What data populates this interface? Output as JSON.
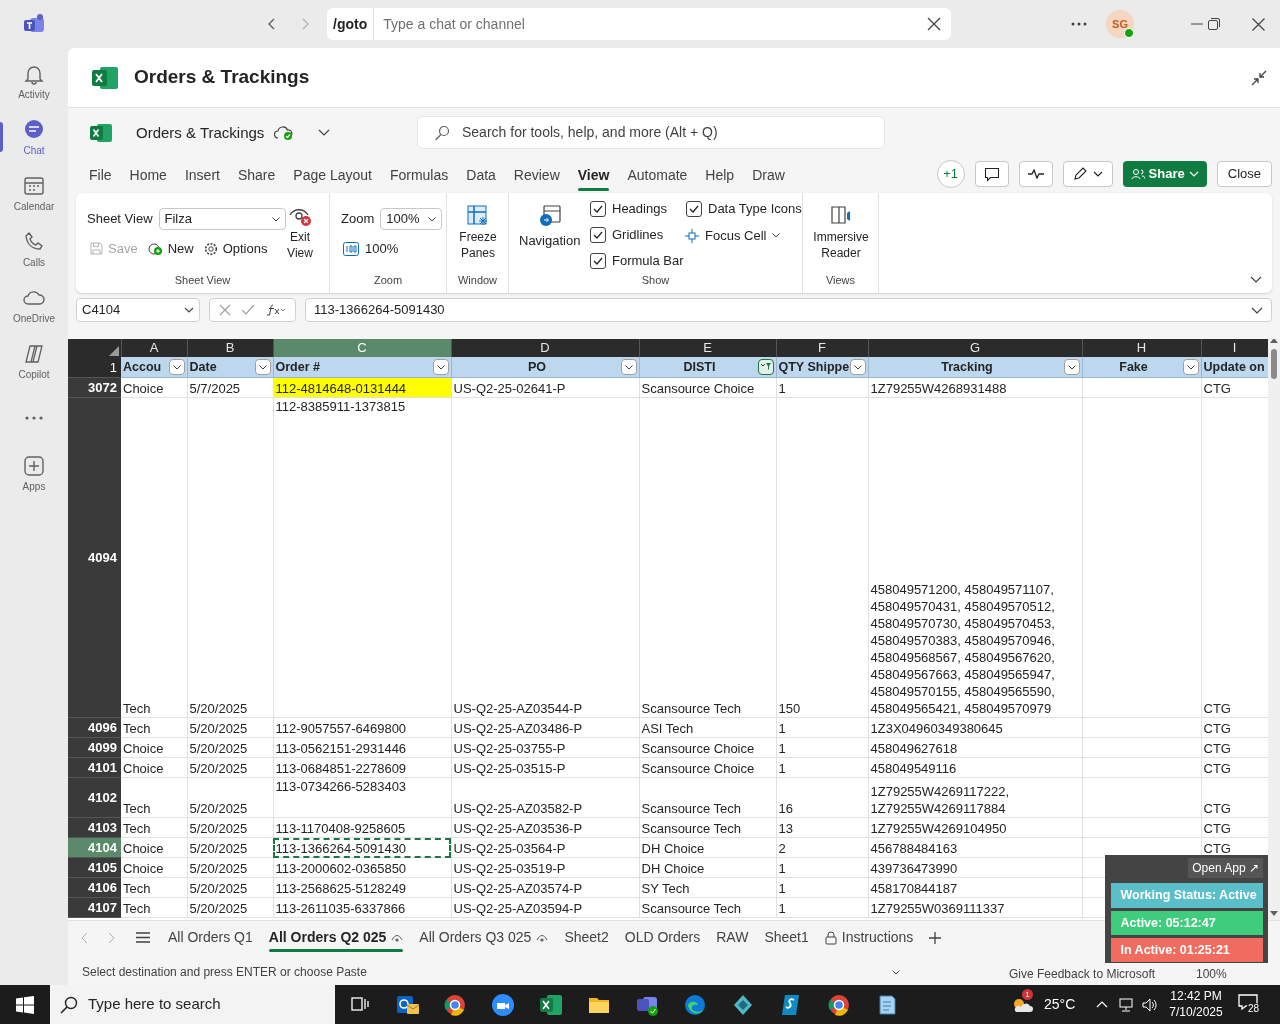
{
  "teams": {
    "search_prefix": "/goto",
    "search_placeholder": "Type a chat or channel",
    "avatar": "SG",
    "rail": [
      {
        "kind": "bell",
        "label": "Activity",
        "selected": false
      },
      {
        "kind": "chat",
        "label": "Chat",
        "selected": true
      },
      {
        "kind": "calendar",
        "label": "Calendar",
        "selected": false
      },
      {
        "kind": "phone",
        "label": "Calls",
        "selected": false
      },
      {
        "kind": "cloud",
        "label": "OneDrive",
        "selected": false
      },
      {
        "kind": "copilot",
        "label": "Copilot",
        "selected": false
      },
      {
        "kind": "more",
        "selected": false
      },
      {
        "kind": "apps",
        "label": "Apps",
        "selected": false
      }
    ]
  },
  "app_title": "Orders & Trackings",
  "workbook": {
    "name": "Orders & Trackings",
    "search_placeholder": "Search for tools, help, and more (Alt + Q)"
  },
  "ribbon_tabs": [
    {
      "label": "File",
      "selected": false
    },
    {
      "label": "Home",
      "selected": false
    },
    {
      "label": "Insert",
      "selected": false
    },
    {
      "label": "Share",
      "selected": false
    },
    {
      "label": "Page Layout",
      "selected": false
    },
    {
      "label": "Formulas",
      "selected": false
    },
    {
      "label": "Data",
      "selected": false
    },
    {
      "label": "Review",
      "selected": false
    },
    {
      "label": "View",
      "selected": true
    },
    {
      "label": "Automate",
      "selected": false
    },
    {
      "label": "Help",
      "selected": false
    },
    {
      "label": "Draw",
      "selected": false
    }
  ],
  "ribbon_actions": {
    "presence": "+1",
    "share": "Share",
    "close": "Close"
  },
  "sheet_view_group": {
    "title": "Sheet View",
    "label": "Sheet View",
    "view": "Filza",
    "exit": "Exit View",
    "save": {
      "label": "Save",
      "disabled": true
    },
    "new": "New",
    "options": "Options"
  },
  "zoom_group": {
    "title": "Zoom",
    "label": "Zoom",
    "value": "100%",
    "reset": "100%"
  },
  "window_group": {
    "title": "Window",
    "freeze": "Freeze Panes"
  },
  "show_group": {
    "title": "Show",
    "navigation": "Navigation",
    "options": [
      {
        "label": "Headings",
        "checked": true
      },
      {
        "label": "Gridlines",
        "checked": true
      },
      {
        "label": "Formula Bar",
        "checked": true
      },
      {
        "label": "Data Type Icons",
        "checked": true
      }
    ],
    "focus_cell": "Focus Cell"
  },
  "views_group": {
    "title": "Views",
    "immersive": "Immersive Reader"
  },
  "formula_bar": {
    "name_box": "C4104",
    "formula": "113-1366264-5091430"
  },
  "sheet": {
    "header_row": "1",
    "columns": [
      {
        "letter": "A",
        "label": "Accou",
        "filtered": false
      },
      {
        "letter": "B",
        "label": "Date",
        "filtered": false
      },
      {
        "letter": "C",
        "label": "Order #",
        "filtered": false
      },
      {
        "letter": "D",
        "label": "PO",
        "filtered": false
      },
      {
        "letter": "E",
        "label": "DISTI",
        "filtered": true
      },
      {
        "letter": "F",
        "label": "QTY Shippe",
        "filtered": false
      },
      {
        "letter": "G",
        "label": "Tracking",
        "filtered": false
      },
      {
        "letter": "H",
        "label": "Fake",
        "filtered": false
      },
      {
        "letter": "I",
        "label": "Update on"
      }
    ],
    "rows": [
      {
        "number": "3072",
        "cells": [
          "Choice",
          "5/7/2025",
          {
            "text": "112-4814648-0131444",
            "highlighted": true
          },
          "US-Q2-25-02641-P",
          "Scansource Choice",
          "1",
          "1Z79255W4268931488",
          null,
          "CTG"
        ]
      },
      {
        "number": "4094",
        "cells": [
          "Tech",
          "5/20/2025",
          {
            "text": "112-8385911-1373815",
            "top": true
          },
          "US-Q2-25-AZ03544-P",
          "Scansource Tech",
          "150",
          "458049571200, 458049571107, 458049570431, 458049570512, 458049570730, 458049570453, 458049570383, 458049570946, 458049568567, 458049567620, 458049567663, 458049565947, 458049570155, 458049565590, 458049565421, 458049570979",
          null,
          "CTG"
        ]
      },
      {
        "number": "4096",
        "cells": [
          "Tech",
          "5/20/2025",
          "112-9057557-6469800",
          "US-Q2-25-AZ03486-P",
          "ASI Tech",
          "1",
          "1Z3X04960349380645",
          null,
          "CTG"
        ]
      },
      {
        "number": "4099",
        "cells": [
          "Choice",
          "5/20/2025",
          "113-0562151-2931446",
          "US-Q2-25-03755-P",
          "Scansource Choice",
          "1",
          "458049627618",
          null,
          "CTG"
        ]
      },
      {
        "number": "4101",
        "cells": [
          "Choice",
          "5/20/2025",
          "113-0684851-2278609",
          "US-Q2-25-03515-P",
          "Scansource Choice",
          "1",
          "458049549116",
          null,
          "CTG"
        ]
      },
      {
        "number": "4102",
        "cells": [
          "Tech",
          "5/20/2025",
          {
            "text": "113-0734266-5283403",
            "top": true
          },
          "US-Q2-25-AZ03582-P",
          "Scansource Tech",
          "16",
          "1Z79255W4269117222, 1Z79255W4269117884",
          null,
          "CTG"
        ]
      },
      {
        "number": "4103",
        "cells": [
          "Tech",
          "5/20/2025",
          "113-1170408-9258605",
          "US-Q2-25-AZ03536-P",
          "Scansource Tech",
          "13",
          "1Z79255W4269104950",
          null,
          "CTG"
        ]
      },
      {
        "number": "4104",
        "cells": [
          "Choice",
          "5/20/2025",
          {
            "text": "113-1366264-5091430",
            "selected": true
          },
          "US-Q2-25-03564-P",
          "DH Choice",
          "2",
          "456788484163",
          null,
          "CTG"
        ]
      },
      {
        "number": "4105",
        "cells": [
          "Choice",
          "5/20/2025",
          "113-2000602-0365850",
          "US-Q2-25-03519-P",
          "DH Choice",
          "1",
          "439736473990",
          null,
          null
        ]
      },
      {
        "number": "4106",
        "cells": [
          "Tech",
          "5/20/2025",
          "113-2568625-5128249",
          "US-Q2-25-AZ03574-P",
          "SY Tech",
          "1",
          "458170844187",
          null,
          null
        ]
      },
      {
        "number": "4107",
        "cells": [
          "Tech",
          "5/20/2025",
          "113-2611035-6337866",
          "US-Q2-25-AZ03594-P",
          "Scansource Tech",
          "1",
          "1Z79255W0369111337",
          null,
          null
        ]
      }
    ]
  },
  "sheet_tabs": [
    {
      "label": "All Orders Q1",
      "selected": false,
      "kind": "plain"
    },
    {
      "label": "All Orders Q2 025",
      "selected": true,
      "kind": "eye"
    },
    {
      "label": "All Orders Q3 025",
      "selected": false,
      "kind": "eye"
    },
    {
      "label": "Sheet2",
      "selected": false,
      "kind": "plain"
    },
    {
      "label": "OLD Orders",
      "selected": false,
      "kind": "plain"
    },
    {
      "label": "RAW",
      "selected": false,
      "kind": "plain"
    },
    {
      "label": "Sheet1",
      "selected": false,
      "kind": "plain"
    },
    {
      "label": "Instructions",
      "selected": false,
      "kind": "locked"
    }
  ],
  "status_bar": {
    "message": "Select destination and press ENTER or choose Paste",
    "feedback": "Give Feedback to Microsoft",
    "zoom": "100%"
  },
  "tracker": {
    "open_app": "Open App ↗",
    "status": "Working Status: Active",
    "active": "Active: 05:12:47",
    "inactive": "In Active: 01:25:21"
  },
  "taskbar": {
    "search_placeholder": "Type here to search",
    "weather_badge": "1",
    "temperature": "25°C",
    "time": "12:42 PM",
    "date": "7/10/2025",
    "notifications": "28",
    "apps": [
      {
        "kind": "mail"
      },
      {
        "kind": "browser"
      },
      {
        "kind": "video"
      },
      {
        "kind": "spreadsheet"
      },
      {
        "kind": "folder"
      },
      {
        "kind": "teams"
      },
      {
        "kind": "edge"
      },
      {
        "kind": "cube"
      },
      {
        "kind": "script"
      },
      {
        "kind": "browser"
      },
      {
        "kind": "notepad"
      }
    ]
  }
}
